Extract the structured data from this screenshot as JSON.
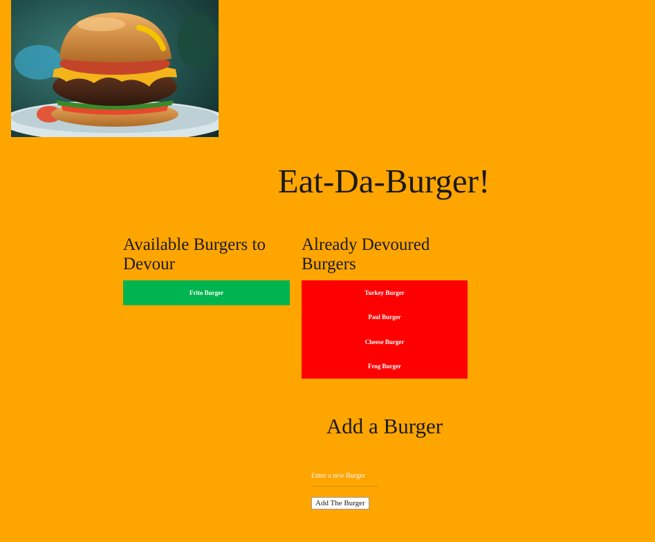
{
  "hero": {
    "image_subject": "burger-photo"
  },
  "page": {
    "title": "Eat-Da-Burger!"
  },
  "columns": {
    "available": {
      "heading": "Available Burgers to Devour",
      "color": "#00B44F",
      "items": [
        "Frito Burger"
      ]
    },
    "devoured": {
      "heading": "Already Devoured Burgers",
      "color": "#FF0000",
      "items": [
        "Turkey Burger",
        "Paul Burger",
        "Cheese Burger",
        "Frog Burger"
      ]
    }
  },
  "add_form": {
    "heading": "Add a Burger",
    "input_value": "",
    "input_placeholder": "Enter a new Burger",
    "submit_label": "Add The Burger"
  },
  "colors": {
    "background": "#FFA500",
    "available_button": "#00B44F",
    "devoured_button": "#FF0000"
  }
}
